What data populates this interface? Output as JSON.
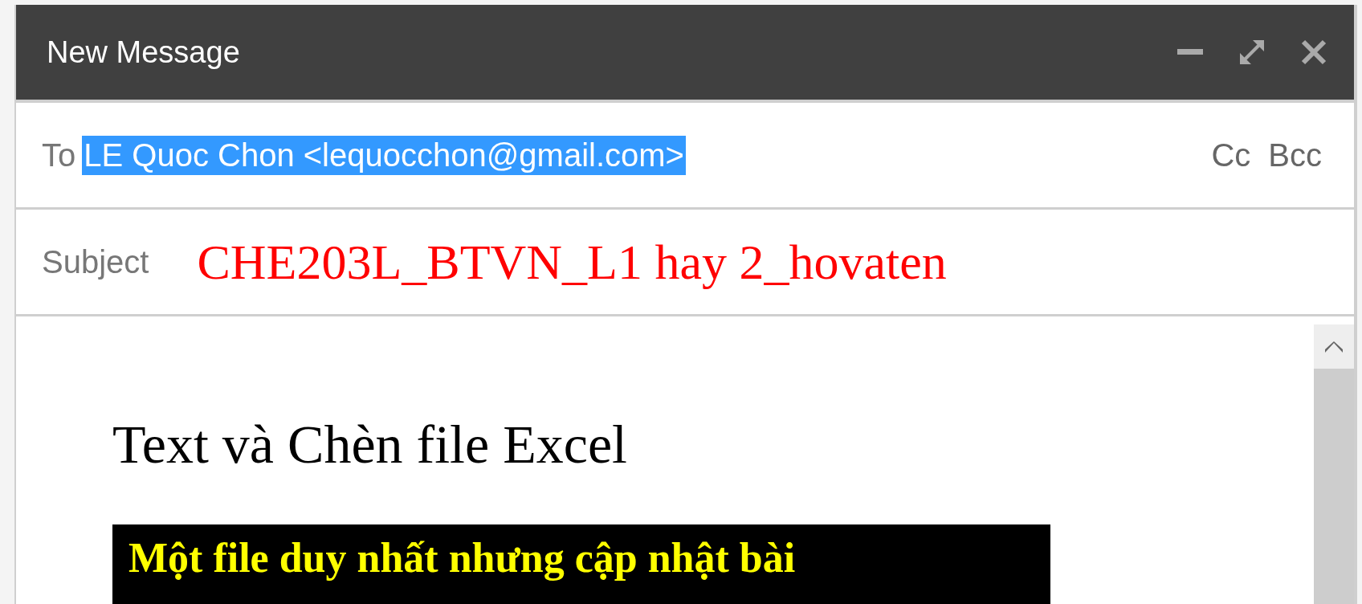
{
  "window": {
    "title": "New Message"
  },
  "to": {
    "label": "To",
    "recipient": "LE Quoc Chon <lequocchon@gmail.com>",
    "selected": true,
    "links": [
      "Cc",
      "Bcc"
    ]
  },
  "subject": {
    "label": "Subject",
    "value": "CHE203L_BTVN_L1 hay 2_hovaten"
  },
  "body": {
    "heading": "Text và Chèn file Excel",
    "note": "Một file duy nhất nhưng cập nhật bài"
  }
}
